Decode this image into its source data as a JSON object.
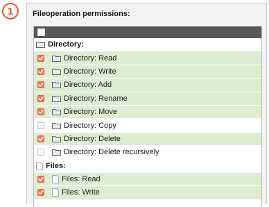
{
  "step_badge": "1",
  "panel": {
    "title": "Fileoperation permissions:",
    "header_checkbox_checked": false
  },
  "rows": [
    {
      "kind": "group",
      "icon": "folder-icon",
      "label": "Directory:"
    },
    {
      "kind": "item",
      "icon": "folder-icon",
      "label": "Directory: Read",
      "checked": true
    },
    {
      "kind": "item",
      "icon": "folder-icon",
      "label": "Directory: Write",
      "checked": true
    },
    {
      "kind": "item",
      "icon": "folder-icon",
      "label": "Directory: Add",
      "checked": true
    },
    {
      "kind": "item",
      "icon": "folder-icon",
      "label": "Directory: Rename",
      "checked": true
    },
    {
      "kind": "item",
      "icon": "folder-icon",
      "label": "Directory: Move",
      "checked": true
    },
    {
      "kind": "item",
      "icon": "folder-icon",
      "label": "Directory: Copy",
      "checked": false
    },
    {
      "kind": "item",
      "icon": "folder-icon",
      "label": "Directory: Delete",
      "checked": true
    },
    {
      "kind": "item",
      "icon": "folder-icon",
      "label": "Directory: Delete recursively",
      "checked": false
    },
    {
      "kind": "group",
      "icon": "file-icon",
      "label": "Files:"
    },
    {
      "kind": "item",
      "icon": "file-icon",
      "label": "Files: Read",
      "checked": true
    },
    {
      "kind": "item",
      "icon": "file-icon",
      "label": "Files: Write",
      "checked": true
    }
  ],
  "colors": {
    "accent": "#e8531e",
    "checked_row": "#dcedd2",
    "checkbox_on": "#ef7a5a",
    "header_bar": "#575757"
  }
}
